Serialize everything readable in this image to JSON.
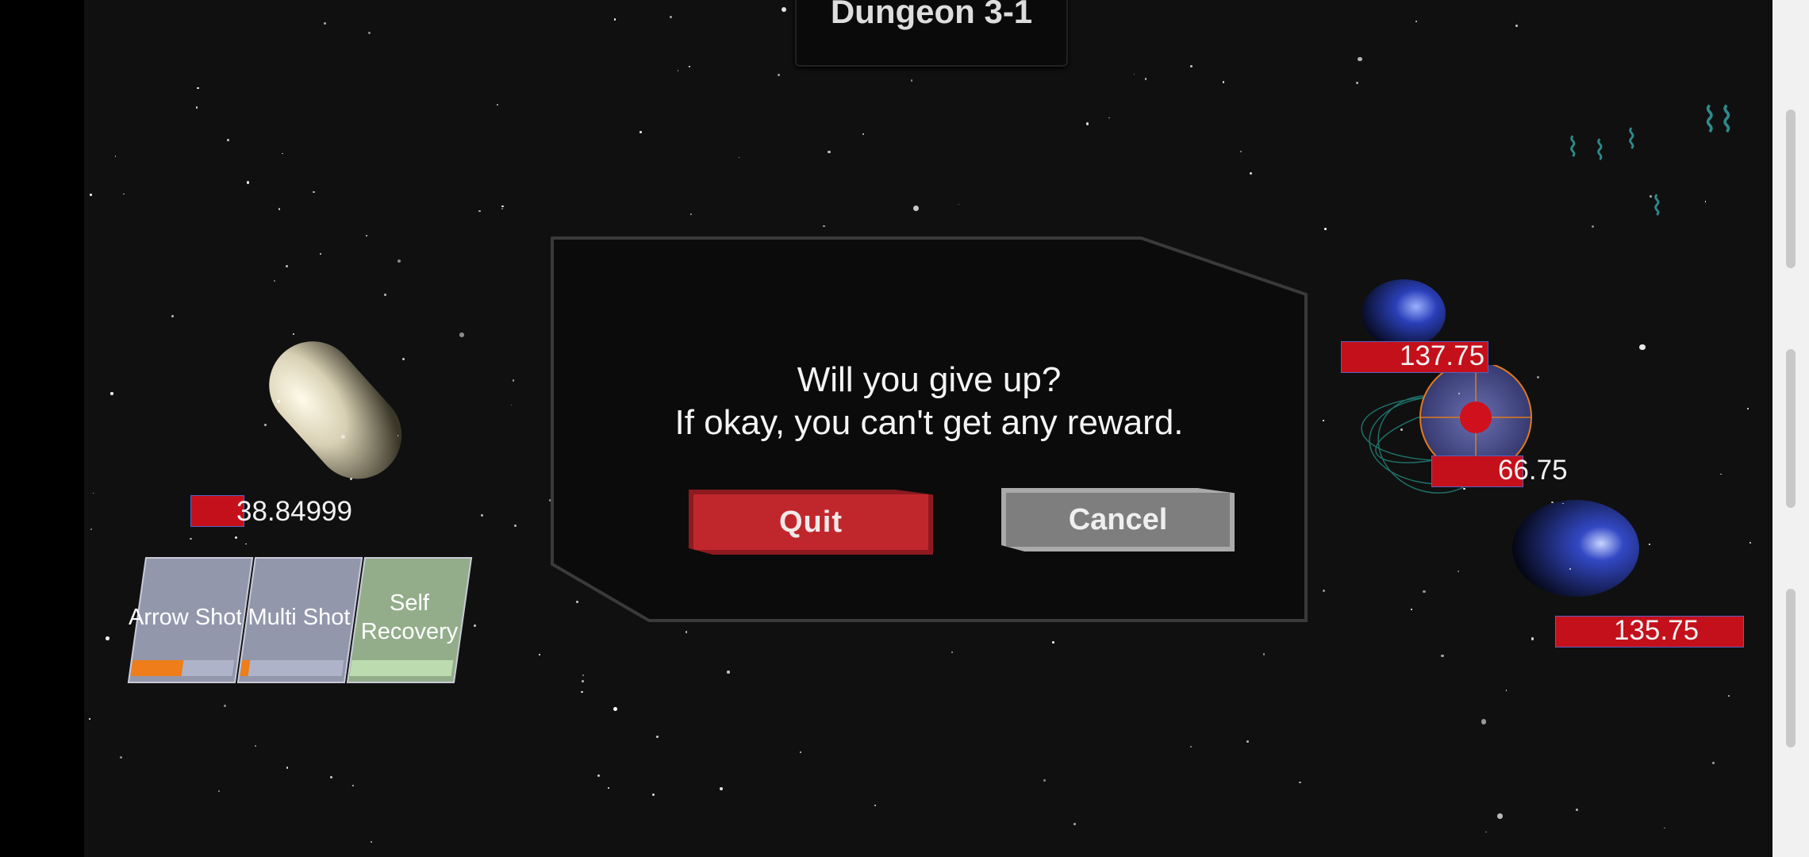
{
  "level": {
    "title": "Dungeon 3-1"
  },
  "dialog": {
    "line1": "Will you give up?",
    "line2": "If okay, you can't get any reward.",
    "quit_label": "Quit",
    "cancel_label": "Cancel"
  },
  "player": {
    "hp_text": "38.84999",
    "hp_fraction": 0.15
  },
  "skills": [
    {
      "label": "Arrow Shot",
      "cooldown_fraction": 0.5,
      "color": "#9397ac"
    },
    {
      "label": "Multi Shot",
      "cooldown_fraction": 0.08,
      "color": "#9397ac"
    },
    {
      "label": "Self\nRecovery",
      "cooldown_fraction": 0,
      "color": "#93ad8a"
    }
  ],
  "enemies": [
    {
      "hp_text": "137.75"
    },
    {
      "hp_text": "66.75"
    },
    {
      "hp_text": "135.75"
    }
  ],
  "colors": {
    "hp_red": "#c4101b",
    "quit_red": "#c0272d",
    "cancel_gray": "#7e7e7e",
    "cooldown_orange": "#ee7d1a"
  },
  "icons": [
    "enemy-marker-icon"
  ]
}
